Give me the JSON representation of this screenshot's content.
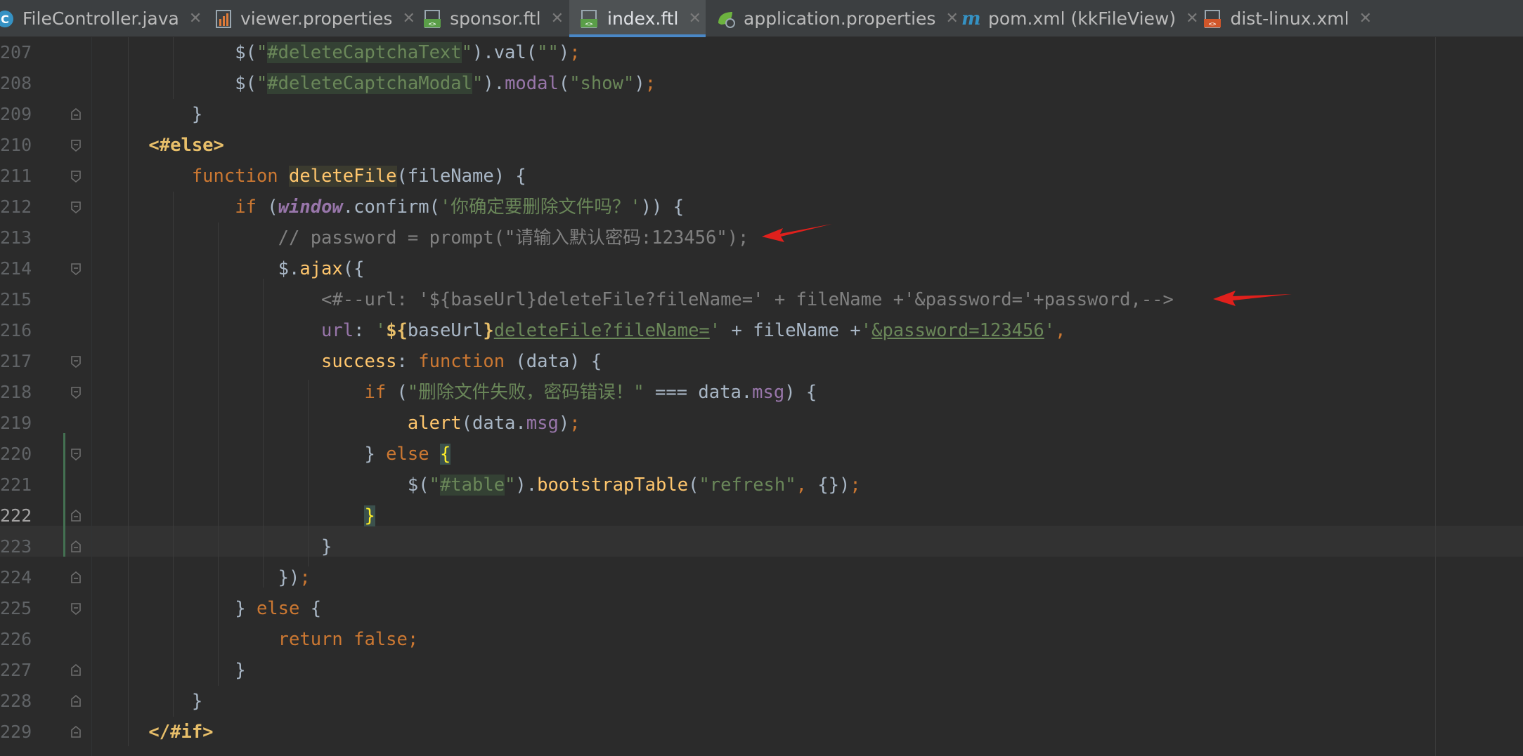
{
  "tabs": [
    {
      "label": "FileController.java",
      "icon": "java-class-icon",
      "active": false
    },
    {
      "label": "viewer.properties",
      "icon": "properties-file-icon",
      "active": false
    },
    {
      "label": "sponsor.ftl",
      "icon": "freemarker-file-icon",
      "active": false
    },
    {
      "label": "index.ftl",
      "icon": "freemarker-file-icon",
      "active": true
    },
    {
      "label": "application.properties",
      "icon": "spring-properties-icon",
      "active": false
    },
    {
      "label": "pom.xml (kkFileView)",
      "icon": "maven-icon",
      "active": false
    },
    {
      "label": "dist-linux.xml",
      "icon": "xml-file-icon",
      "active": false
    }
  ],
  "colors": {
    "accent": "#4a88c7",
    "editor_bg": "#2b2b2b",
    "annotation_arrow": "#e0201c"
  },
  "editor": {
    "current_line": "222",
    "lines": [
      {
        "num": "207",
        "text": "            $(\"#deleteCaptchaText\").val(\"\");"
      },
      {
        "num": "208",
        "text": "            $(\"#deleteCaptchaModal\").modal(\"show\");"
      },
      {
        "num": "209",
        "text": "        }"
      },
      {
        "num": "210",
        "text": "    <#else>"
      },
      {
        "num": "211",
        "text": "        function deleteFile(fileName) {"
      },
      {
        "num": "212",
        "text": "            if (window.confirm('你确定要删除文件吗？')) {"
      },
      {
        "num": "213",
        "text": "                // password = prompt(\"请输入默认密码:123456\");"
      },
      {
        "num": "214",
        "text": "                $.ajax({"
      },
      {
        "num": "215",
        "text": "                    <#--url: '${baseUrl}deleteFile?fileName=' + fileName +'&password='+password,-->"
      },
      {
        "num": "216",
        "text": "                    url: '${baseUrl}deleteFile?fileName=' + fileName +'&password=123456',"
      },
      {
        "num": "217",
        "text": "                    success: function (data) {"
      },
      {
        "num": "218",
        "text": "                        if (\"删除文件失败，密码错误！\" === data.msg) {"
      },
      {
        "num": "219",
        "text": "                            alert(data.msg);"
      },
      {
        "num": "220",
        "text": "                        } else {"
      },
      {
        "num": "221",
        "text": "                            $(\"#table\").bootstrapTable(\"refresh\", {});"
      },
      {
        "num": "222",
        "text": "                        }"
      },
      {
        "num": "223",
        "text": "                    }"
      },
      {
        "num": "224",
        "text": "                });"
      },
      {
        "num": "225",
        "text": "            } else {"
      },
      {
        "num": "226",
        "text": "                return false;"
      },
      {
        "num": "227",
        "text": "            }"
      },
      {
        "num": "228",
        "text": "        }"
      },
      {
        "num": "229",
        "text": "    </#if>"
      }
    ]
  }
}
